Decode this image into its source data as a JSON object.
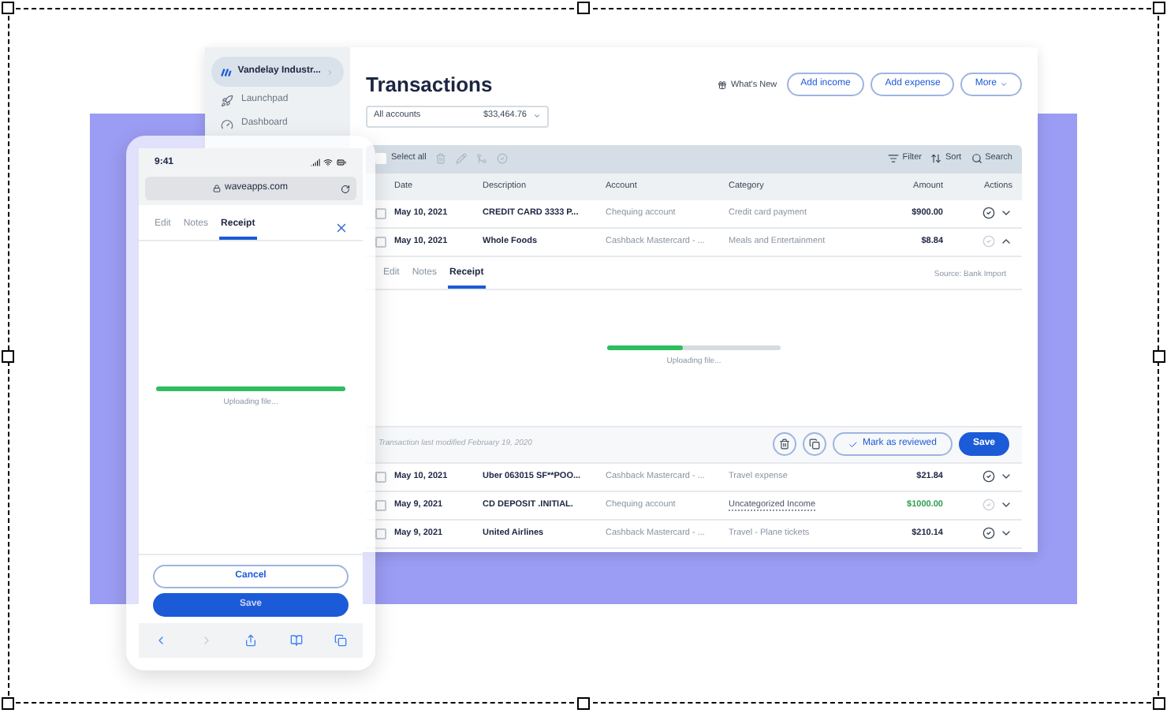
{
  "sidebar": {
    "org": "Vandelay Industr...",
    "items": [
      {
        "label": "Launchpad",
        "kind": "launchpad"
      },
      {
        "label": "Dashboard",
        "kind": "dashboard"
      }
    ]
  },
  "header": {
    "title": "Transactions",
    "whats_new": "What's New",
    "buttons": [
      "Add income",
      "Add expense",
      "More"
    ]
  },
  "account_select": {
    "value": "All accounts",
    "balance": "$33,464.76"
  },
  "toolbar": {
    "select_all": {
      "label": "Select all",
      "checked": false
    },
    "actions": [
      {
        "label": "Filter",
        "kind": "filter"
      },
      {
        "label": "Sort",
        "kind": "sort"
      },
      {
        "label": "Search",
        "kind": "search"
      }
    ]
  },
  "table": {
    "columns": [
      "Date",
      "Description",
      "Account",
      "Category",
      "Amount",
      "Actions"
    ],
    "rows": [
      {
        "date": "May 10, 2021",
        "description": "CREDIT CARD 3333 P...",
        "account": "Chequing account",
        "category": "Credit card payment",
        "amount": "$900.00",
        "checked": false,
        "income": false,
        "uncategorized": false,
        "reviewed": true,
        "expanded": false
      },
      {
        "date": "May 10, 2021",
        "description": "Whole Foods",
        "account": "Cashback Mastercard - ...",
        "category": "Meals and Entertainment",
        "amount": "$8.84",
        "checked": false,
        "income": false,
        "uncategorized": false,
        "reviewed": false,
        "expanded": true
      },
      {
        "date": "May 10, 2021",
        "description": "Uber 063015 SF**POO...",
        "account": "Cashback Mastercard - ...",
        "category": "Travel expense",
        "amount": "$21.84",
        "checked": false,
        "income": false,
        "uncategorized": false,
        "reviewed": true,
        "expanded": false
      },
      {
        "date": "May 9, 2021",
        "description": "CD DEPOSIT .INITIAL.",
        "account": "Chequing account",
        "category": "Uncategorized Income",
        "amount": "$1000.00",
        "checked": false,
        "income": true,
        "uncategorized": true,
        "reviewed": false,
        "expanded": false
      },
      {
        "date": "May 9, 2021",
        "description": "United Airlines",
        "account": "Cashback Mastercard - ...",
        "category": "Travel - Plane tickets",
        "amount": "$210.14",
        "checked": false,
        "income": false,
        "uncategorized": false,
        "reviewed": true,
        "expanded": false
      }
    ]
  },
  "detail": {
    "tabs": [
      {
        "label": "Edit",
        "selected": false
      },
      {
        "label": "Notes",
        "selected": false
      },
      {
        "label": "Receipt",
        "selected": true
      }
    ],
    "source": "Source: Bank Import",
    "upload": {
      "level": 0.44,
      "status": "Uploading file..."
    },
    "modified": "Transaction last modified February 19, 2020",
    "review_button": "Mark as reviewed",
    "save_button": "Save"
  },
  "phone": {
    "time": "9:41",
    "url": "waveapps.com",
    "tabs": [
      {
        "label": "Edit",
        "selected": false
      },
      {
        "label": "Notes",
        "selected": false
      },
      {
        "label": "Receipt",
        "selected": true
      }
    ],
    "upload": {
      "level": 1,
      "status": "Uploading file..."
    },
    "cancel_button": "Cancel",
    "save_button": "Save"
  }
}
